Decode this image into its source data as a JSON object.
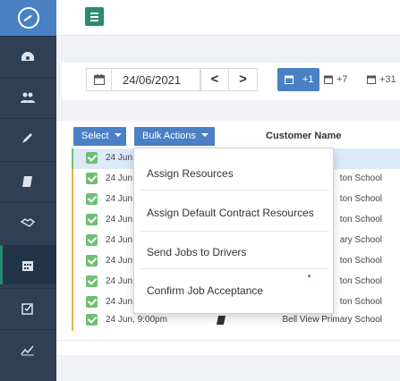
{
  "sidebar": {
    "logo_icon": "app-logo-icon",
    "items": [
      {
        "icon": "dashboard-icon"
      },
      {
        "icon": "users-icon"
      },
      {
        "icon": "pencil-icon"
      },
      {
        "icon": "book-icon"
      },
      {
        "icon": "handshake-icon"
      },
      {
        "icon": "calendar-icon",
        "active": true
      },
      {
        "icon": "checklist-icon"
      },
      {
        "icon": "chart-icon"
      }
    ]
  },
  "toolbar": {
    "menu_icon": "hamburger-icon",
    "date_value": "24/06/2021",
    "prev_label": "<",
    "next_label": ">",
    "range_buttons": [
      {
        "label": "+1",
        "active": true
      },
      {
        "label": "+7",
        "active": false
      },
      {
        "label": "+31",
        "active": false
      }
    ]
  },
  "actions": {
    "select_label": "Select",
    "bulk_label": "Bulk Actions"
  },
  "table": {
    "customer_header": "Customer Name",
    "rows": [
      {
        "date": "24 Jun",
        "customer": ""
      },
      {
        "date": "24 Jun",
        "customer": "ton School"
      },
      {
        "date": "24 Jun",
        "customer": "ton School"
      },
      {
        "date": "24 Jun",
        "customer": "ton School"
      },
      {
        "date": "24 Jun",
        "customer": "ary School"
      },
      {
        "date": "24 Jun",
        "customer": "ton School"
      },
      {
        "date": "24 Jun",
        "customer": "ton School"
      },
      {
        "date": "24 Jun",
        "customer": "ton School"
      },
      {
        "date": "24 Jun, 9:00pm",
        "customer": "Bell View Primary School"
      }
    ]
  },
  "bulk_menu": {
    "items": [
      "Assign Resources",
      "Assign Default Contract Resources",
      "Send Jobs to Drivers",
      "Confirm Job Acceptance"
    ]
  },
  "colors": {
    "sidebar_bg": "#2f3f55",
    "accent_blue": "#4a80c4",
    "accent_green": "#2c8a72",
    "checkbox_green": "#6fbf72",
    "row_highlight": "#dce9f7"
  }
}
